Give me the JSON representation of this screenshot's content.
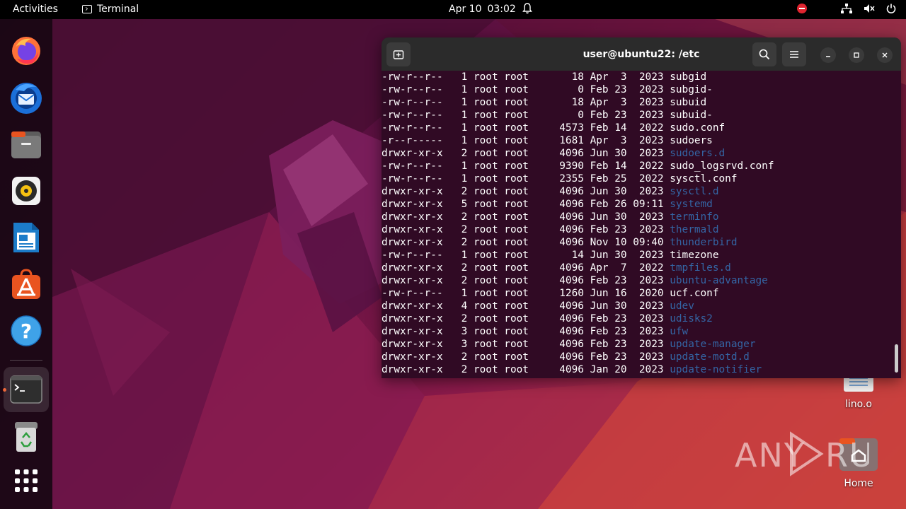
{
  "topbar": {
    "activities": "Activities",
    "app_name": "Terminal",
    "date": "Apr 10",
    "time": "03:02"
  },
  "dock": {
    "items": [
      {
        "name": "firefox-icon"
      },
      {
        "name": "thunderbird-icon"
      },
      {
        "name": "files-icon"
      },
      {
        "name": "rhythmbox-icon"
      },
      {
        "name": "libreoffice-writer-icon"
      },
      {
        "name": "app-center-icon"
      },
      {
        "name": "help-icon"
      },
      {
        "name": "terminal-icon"
      },
      {
        "name": "trash-icon"
      },
      {
        "name": "show-apps-icon"
      }
    ]
  },
  "desktop": {
    "icons": [
      {
        "label": "lino.o"
      },
      {
        "label": "Home"
      }
    ],
    "watermark": "ANY RUN"
  },
  "terminal": {
    "title": "user@ubuntu22: /etc",
    "colors": {
      "background": "#300a24",
      "text": "#ffffff",
      "directory": "#3465a4"
    },
    "lines": [
      {
        "perm": "-rw-r--r--",
        "links": "1",
        "owner": "root",
        "group": "root",
        "size": "18",
        "month": "Apr",
        "day": "3",
        "time": "2023",
        "name": "subgid",
        "is_dir": false
      },
      {
        "perm": "-rw-r--r--",
        "links": "1",
        "owner": "root",
        "group": "root",
        "size": "0",
        "month": "Feb",
        "day": "23",
        "time": "2023",
        "name": "subgid-",
        "is_dir": false
      },
      {
        "perm": "-rw-r--r--",
        "links": "1",
        "owner": "root",
        "group": "root",
        "size": "18",
        "month": "Apr",
        "day": "3",
        "time": "2023",
        "name": "subuid",
        "is_dir": false
      },
      {
        "perm": "-rw-r--r--",
        "links": "1",
        "owner": "root",
        "group": "root",
        "size": "0",
        "month": "Feb",
        "day": "23",
        "time": "2023",
        "name": "subuid-",
        "is_dir": false
      },
      {
        "perm": "-rw-r--r--",
        "links": "1",
        "owner": "root",
        "group": "root",
        "size": "4573",
        "month": "Feb",
        "day": "14",
        "time": "2022",
        "name": "sudo.conf",
        "is_dir": false
      },
      {
        "perm": "-r--r-----",
        "links": "1",
        "owner": "root",
        "group": "root",
        "size": "1681",
        "month": "Apr",
        "day": "3",
        "time": "2023",
        "name": "sudoers",
        "is_dir": false
      },
      {
        "perm": "drwxr-xr-x",
        "links": "2",
        "owner": "root",
        "group": "root",
        "size": "4096",
        "month": "Jun",
        "day": "30",
        "time": "2023",
        "name": "sudoers.d",
        "is_dir": true
      },
      {
        "perm": "-rw-r--r--",
        "links": "1",
        "owner": "root",
        "group": "root",
        "size": "9390",
        "month": "Feb",
        "day": "14",
        "time": "2022",
        "name": "sudo_logsrvd.conf",
        "is_dir": false
      },
      {
        "perm": "-rw-r--r--",
        "links": "1",
        "owner": "root",
        "group": "root",
        "size": "2355",
        "month": "Feb",
        "day": "25",
        "time": "2022",
        "name": "sysctl.conf",
        "is_dir": false
      },
      {
        "perm": "drwxr-xr-x",
        "links": "2",
        "owner": "root",
        "group": "root",
        "size": "4096",
        "month": "Jun",
        "day": "30",
        "time": "2023",
        "name": "sysctl.d",
        "is_dir": true
      },
      {
        "perm": "drwxr-xr-x",
        "links": "5",
        "owner": "root",
        "group": "root",
        "size": "4096",
        "month": "Feb",
        "day": "26",
        "time": "09:11",
        "name": "systemd",
        "is_dir": true
      },
      {
        "perm": "drwxr-xr-x",
        "links": "2",
        "owner": "root",
        "group": "root",
        "size": "4096",
        "month": "Jun",
        "day": "30",
        "time": "2023",
        "name": "terminfo",
        "is_dir": true
      },
      {
        "perm": "drwxr-xr-x",
        "links": "2",
        "owner": "root",
        "group": "root",
        "size": "4096",
        "month": "Feb",
        "day": "23",
        "time": "2023",
        "name": "thermald",
        "is_dir": true
      },
      {
        "perm": "drwxr-xr-x",
        "links": "2",
        "owner": "root",
        "group": "root",
        "size": "4096",
        "month": "Nov",
        "day": "10",
        "time": "09:40",
        "name": "thunderbird",
        "is_dir": true
      },
      {
        "perm": "-rw-r--r--",
        "links": "1",
        "owner": "root",
        "group": "root",
        "size": "14",
        "month": "Jun",
        "day": "30",
        "time": "2023",
        "name": "timezone",
        "is_dir": false
      },
      {
        "perm": "drwxr-xr-x",
        "links": "2",
        "owner": "root",
        "group": "root",
        "size": "4096",
        "month": "Apr",
        "day": "7",
        "time": "2022",
        "name": "tmpfiles.d",
        "is_dir": true
      },
      {
        "perm": "drwxr-xr-x",
        "links": "2",
        "owner": "root",
        "group": "root",
        "size": "4096",
        "month": "Feb",
        "day": "23",
        "time": "2023",
        "name": "ubuntu-advantage",
        "is_dir": true
      },
      {
        "perm": "-rw-r--r--",
        "links": "1",
        "owner": "root",
        "group": "root",
        "size": "1260",
        "month": "Jun",
        "day": "16",
        "time": "2020",
        "name": "ucf.conf",
        "is_dir": false
      },
      {
        "perm": "drwxr-xr-x",
        "links": "4",
        "owner": "root",
        "group": "root",
        "size": "4096",
        "month": "Jun",
        "day": "30",
        "time": "2023",
        "name": "udev",
        "is_dir": true
      },
      {
        "perm": "drwxr-xr-x",
        "links": "2",
        "owner": "root",
        "group": "root",
        "size": "4096",
        "month": "Feb",
        "day": "23",
        "time": "2023",
        "name": "udisks2",
        "is_dir": true
      },
      {
        "perm": "drwxr-xr-x",
        "links": "3",
        "owner": "root",
        "group": "root",
        "size": "4096",
        "month": "Feb",
        "day": "23",
        "time": "2023",
        "name": "ufw",
        "is_dir": true
      },
      {
        "perm": "drwxr-xr-x",
        "links": "3",
        "owner": "root",
        "group": "root",
        "size": "4096",
        "month": "Feb",
        "day": "23",
        "time": "2023",
        "name": "update-manager",
        "is_dir": true
      },
      {
        "perm": "drwxr-xr-x",
        "links": "2",
        "owner": "root",
        "group": "root",
        "size": "4096",
        "month": "Feb",
        "day": "23",
        "time": "2023",
        "name": "update-motd.d",
        "is_dir": true
      },
      {
        "perm": "drwxr-xr-x",
        "links": "2",
        "owner": "root",
        "group": "root",
        "size": "4096",
        "month": "Jan",
        "day": "20",
        "time": "2023",
        "name": "update-notifier",
        "is_dir": true
      }
    ]
  }
}
